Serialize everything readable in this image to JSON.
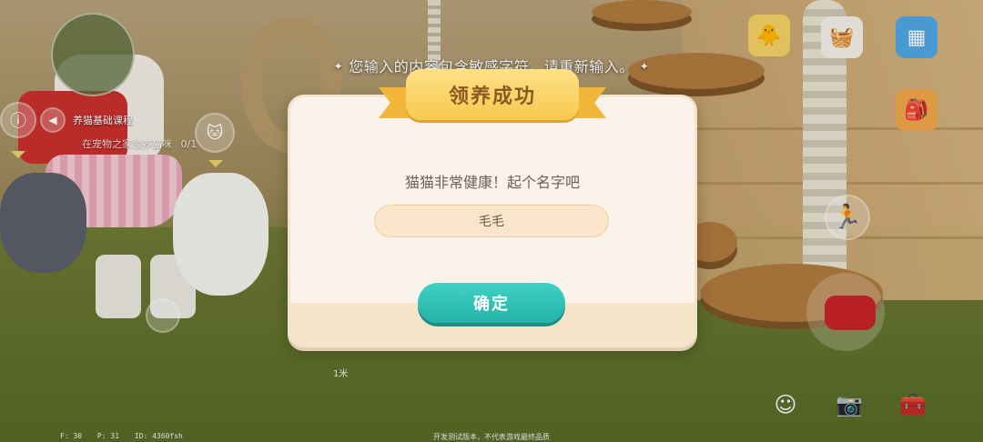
{
  "toast": {
    "message": "您输入的内容包含敏感字符，请重新输入。"
  },
  "quest": {
    "title": "养猫基础课程",
    "subtitle": "在宠物之家领养猫咪",
    "progress": "0/1"
  },
  "ruler": {
    "label": "1米"
  },
  "dialog": {
    "ribbon_title": "领养成功",
    "prompt": "猫猫非常健康！起个名字吧",
    "name_value": "毛毛",
    "confirm_label": "确定"
  },
  "footer": {
    "note": "开发测试版本，不代表游戏最终品质",
    "stats": {
      "f": "F: 30",
      "p": "P: 31",
      "id": "ID: 4360fsh"
    }
  },
  "colors": {
    "confirm": "#2fc1b6",
    "ribbon": "#f7c94e",
    "dialog_bg": "#f9f3ec"
  },
  "icons": {
    "minimap": "minimap-icon",
    "right_top": [
      "pet-avatar-icon",
      "shop-basket-icon",
      "phone-icon",
      "backpack-icon"
    ],
    "bottom": [
      "emote-icon",
      "camera-icon",
      "toolbox-icon"
    ],
    "action": [
      "jump-icon",
      "car-icon"
    ]
  }
}
